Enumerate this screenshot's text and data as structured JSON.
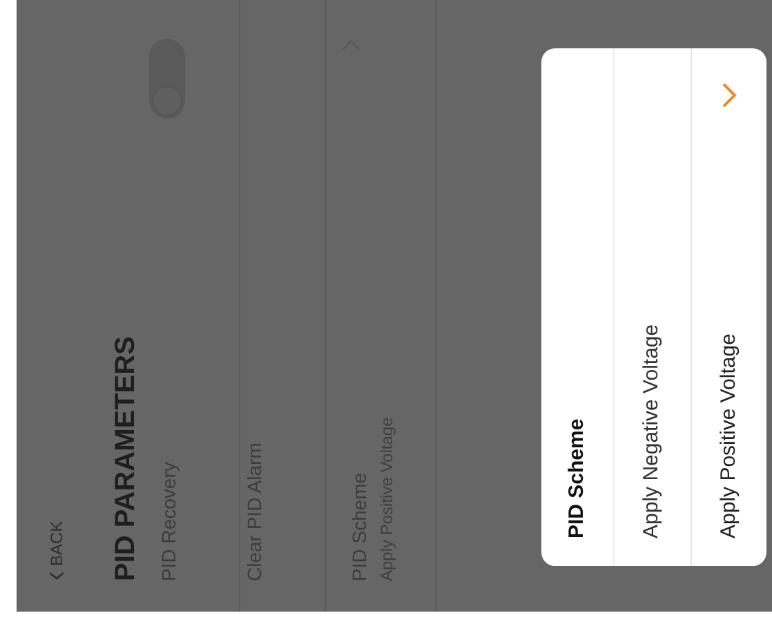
{
  "header": {
    "back": "BACK",
    "title": "PID PARAMETERS"
  },
  "settings": [
    {
      "kind": "toggle",
      "label": "PID Recovery",
      "on": false
    },
    {
      "kind": "action",
      "label": "Clear PID Alarm"
    },
    {
      "kind": "select",
      "label": "PID Scheme",
      "value": "Apply Positive Voltage"
    }
  ],
  "dialog": {
    "title": "PID Scheme",
    "options": [
      {
        "label": "Apply Negative Voltage",
        "selected": false
      },
      {
        "label": "Apply Positive Voltage",
        "selected": true
      }
    ]
  }
}
